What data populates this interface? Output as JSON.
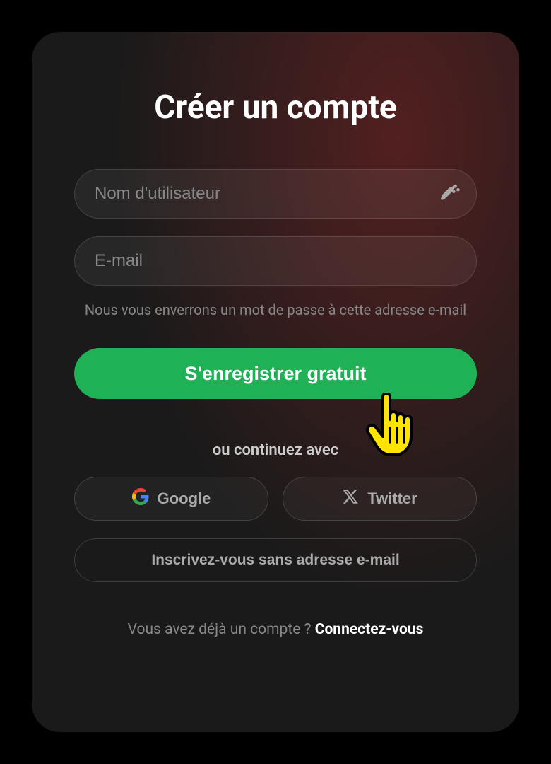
{
  "title": "Créer un compte",
  "username": {
    "placeholder": "Nom d'utilisateur",
    "value": ""
  },
  "email": {
    "placeholder": "E-mail",
    "value": "",
    "helper": "Nous vous enverrons un mot de passe à cette adresse e-mail"
  },
  "primary_button": "S'enregistrer gratuit",
  "divider": "ou continuez avec",
  "social": {
    "google": "Google",
    "twitter": "Twitter"
  },
  "alt_button": "Inscrivez-vous sans adresse e-mail",
  "footer": {
    "prompt": "Vous avez déjà un compte ? ",
    "link": "Connectez-vous"
  },
  "colors": {
    "primary": "#1fb155",
    "cursor": "#ffe400"
  }
}
